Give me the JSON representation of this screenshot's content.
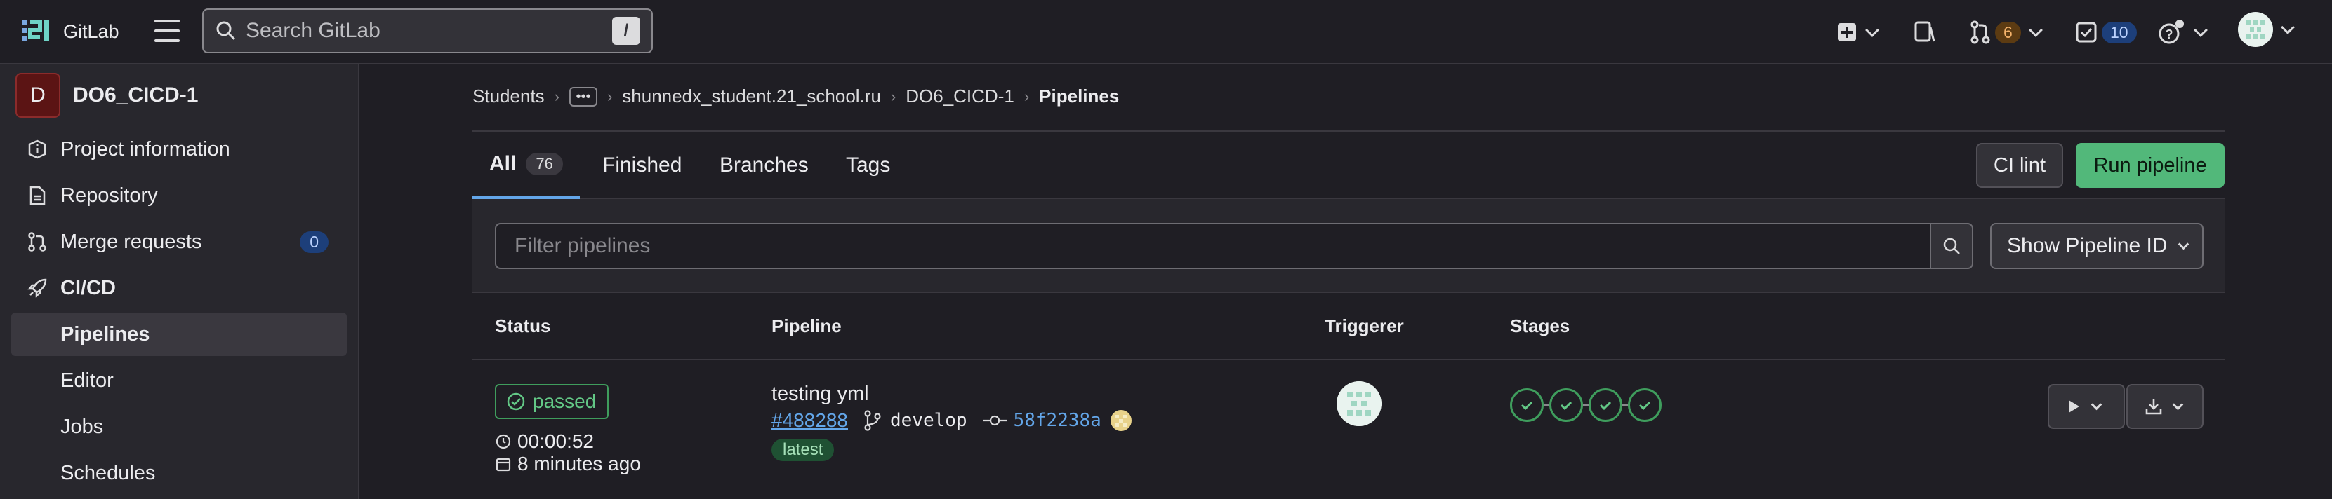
{
  "header": {
    "app_name": "GitLab",
    "search_placeholder": "Search GitLab",
    "search_shortcut": "/",
    "merge_requests_count": "6",
    "todos_count": "10"
  },
  "sidebar": {
    "project_initial": "D",
    "project_name": "DO6_CICD-1",
    "items": [
      {
        "label": "Project information",
        "icon": "info-icon"
      },
      {
        "label": "Repository",
        "icon": "document-icon"
      },
      {
        "label": "Merge requests",
        "icon": "merge-request-icon",
        "badge": "0"
      },
      {
        "label": "CI/CD",
        "icon": "rocket-icon"
      },
      {
        "label": "Pipelines"
      },
      {
        "label": "Editor"
      },
      {
        "label": "Jobs"
      },
      {
        "label": "Schedules"
      }
    ]
  },
  "breadcrumb": {
    "items": [
      "Students",
      "shunnedx_student.21_school.ru",
      "DO6_CICD-1",
      "Pipelines"
    ]
  },
  "tabs": [
    {
      "label": "All",
      "count": "76"
    },
    {
      "label": "Finished"
    },
    {
      "label": "Branches"
    },
    {
      "label": "Tags"
    }
  ],
  "actions": {
    "ci_lint": "CI lint",
    "run_pipeline": "Run pipeline"
  },
  "filter": {
    "placeholder": "Filter pipelines",
    "show_pipeline_id": "Show Pipeline ID"
  },
  "table": {
    "headers": [
      "Status",
      "Pipeline",
      "Triggerer",
      "Stages"
    ],
    "rows": [
      {
        "status": "passed",
        "duration": "00:00:52",
        "finished": "8 minutes ago",
        "title": "testing yml",
        "id": "#488288",
        "branch": "develop",
        "commit": "58f2238a",
        "tag": "latest",
        "stages": [
          "passed",
          "passed",
          "passed",
          "passed"
        ]
      }
    ]
  },
  "colors": {
    "accent_blue": "#63a6e9",
    "success_green": "#52b87a",
    "background": "#1f1e24"
  }
}
